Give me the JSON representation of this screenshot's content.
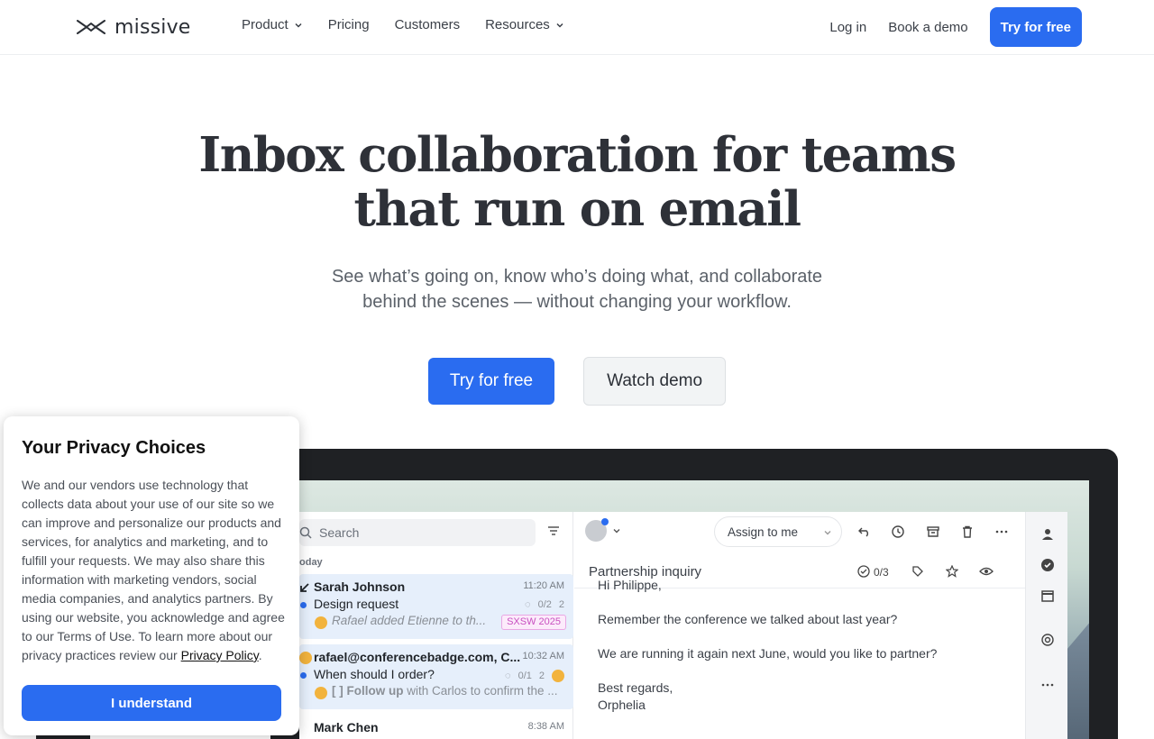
{
  "nav": {
    "logo_text": "missive",
    "links": [
      {
        "label": "Product",
        "has_dropdown": true
      },
      {
        "label": "Pricing",
        "has_dropdown": false
      },
      {
        "label": "Customers",
        "has_dropdown": false
      },
      {
        "label": "Resources",
        "has_dropdown": true
      }
    ],
    "login": "Log in",
    "book_demo": "Book a demo",
    "cta": "Try for free"
  },
  "hero": {
    "title_line1": "Inbox collaboration for teams",
    "title_line2": "that run on email",
    "subtitle_line1": "See what’s going on, know who’s doing what, and collaborate",
    "subtitle_line2": "behind the scenes — without changing your workflow.",
    "primary_cta": "Try for free",
    "secondary_cta": "Watch demo"
  },
  "app": {
    "search_placeholder": "Search",
    "section_label": "oday",
    "assign_label": "Assign to me",
    "subject": "Partnership inquiry",
    "task_count": "0/3",
    "conversations": [
      {
        "from": "Sarah Johnson",
        "time": "11:20 AM",
        "subject": "Design request",
        "tasks": "0/2",
        "count": "2",
        "preview": "Rafael added Etienne to th...",
        "tag": "SXSW 2025"
      },
      {
        "from": "rafael@conferencebadge.com, C...",
        "time": "10:32 AM",
        "subject": "When should I order?",
        "tasks": "0/1",
        "count": "2",
        "preview_bold": "[ ] Follow up",
        "preview": " with Carlos to confirm the ..."
      },
      {
        "from": "Mark Chen",
        "time": "8:38 AM"
      }
    ],
    "email_body": {
      "greeting": "Hi Philippe,",
      "p1": "Remember the conference we talked about last year?",
      "p2": "We are running it again next June, would you like to partner?",
      "signoff": "Best regards,",
      "name": "Orphelia"
    }
  },
  "privacy": {
    "title": "Your Privacy Choices",
    "body": "We and our vendors use technology that collects data about your use of our site so we can improve and personalize our products and services, for analytics and marketing, and to fulfill your requests. We may also share this information with marketing vendors, social media companies, and analytics partners. By using our website, you acknowledge and agree to our Terms of Use. To learn more about our privacy practices review our ",
    "link": "Privacy Policy",
    "period": ".",
    "button": "I understand"
  },
  "colors": {
    "brand_blue": "#2a6cf0",
    "tag_pink": "#c850c0"
  }
}
